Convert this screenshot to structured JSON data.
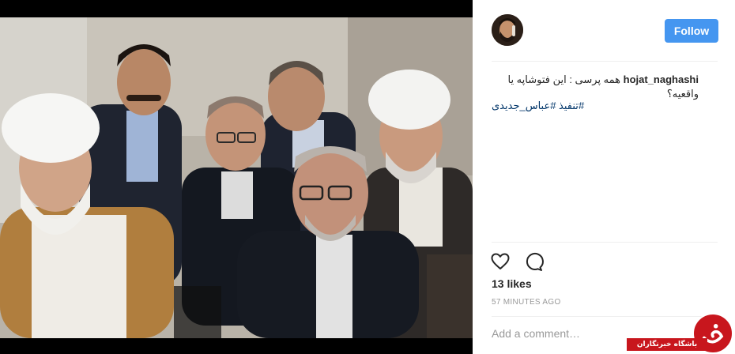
{
  "post": {
    "username": "hojat_naghashi",
    "caption": "همه پرسی : این فتوشاپه یا واقعیه؟",
    "hashtags": "تنفیذ #عباس_جدیدی#",
    "likes": "13 likes",
    "timestamp": "57 MINUTES AGO",
    "media_description_icon": "photo-of-seated-men"
  },
  "header": {
    "follow_label": "Follow",
    "avatar_icon": "avatar-icon"
  },
  "actions": {
    "like_icon": "heart-icon",
    "comment_icon": "comment-icon"
  },
  "comment_box": {
    "placeholder": "Add a comment…"
  },
  "watermark": {
    "text": "باشگاه خبرنگاران",
    "logo": "ybc-logo"
  },
  "colors": {
    "follow_button": "#4596f0",
    "hashtag": "#003569",
    "watermark": "#c8161d",
    "media_background": "#000000"
  }
}
